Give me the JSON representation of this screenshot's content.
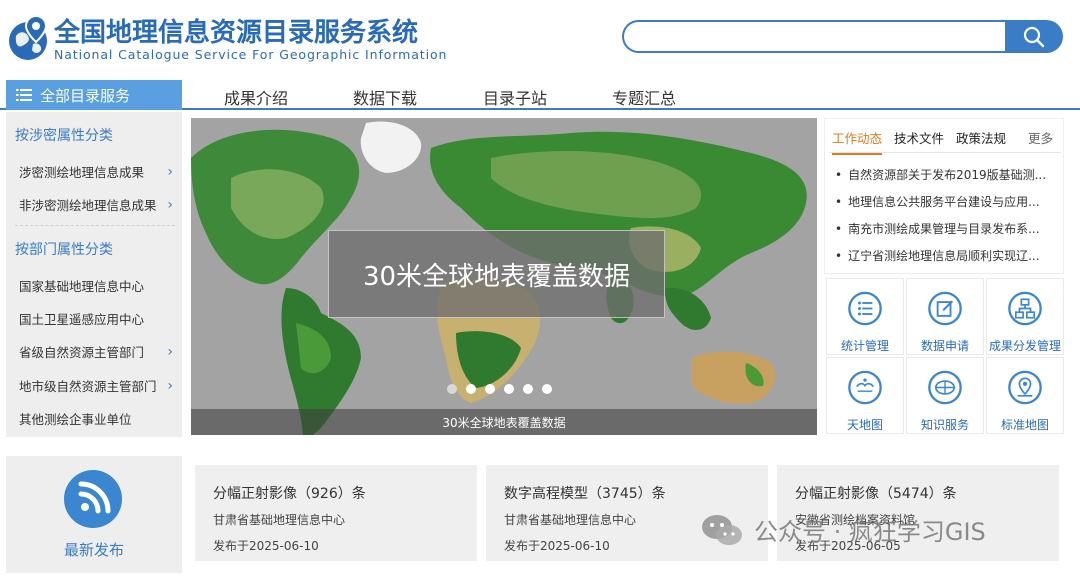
{
  "header": {
    "title_cn": "全国地理信息资源目录服务系统",
    "title_en": "National Catalogue Service For Geographic Information",
    "search": {
      "value": "",
      "placeholder": ""
    }
  },
  "nav": {
    "all_label": "全部目录服务",
    "items": [
      "成果介绍",
      "数据下载",
      "目录子站",
      "专题汇总"
    ]
  },
  "sidebar": {
    "group1_title": "按涉密属性分类",
    "group1_items": [
      "涉密测绘地理信息成果",
      "非涉密测绘地理信息成果"
    ],
    "group2_title": "按部门属性分类",
    "group2_items": [
      "国家基础地理信息中心",
      "国土卫星遥感应用中心",
      "省级自然资源主管部门",
      "地市级自然资源主管部门",
      "其他测绘企事业单位"
    ]
  },
  "banner": {
    "caption": "30米全球地表覆盖数据",
    "bottom_caption": "30米全球地表覆盖数据",
    "slide_count": 6,
    "active_index": 0
  },
  "news": {
    "tabs": [
      "工作动态",
      "技术文件",
      "政策法规"
    ],
    "more": "更多",
    "items": [
      "自然资源部关于发布2019版基础测...",
      "地理信息公共服务平台建设与应用...",
      "南充市测绘成果管理与目录发布系...",
      "辽宁省测绘地理信息局顺利实现辽..."
    ]
  },
  "services": [
    {
      "label": "统计管理",
      "icon": "list-icon"
    },
    {
      "label": "数据申请",
      "icon": "edit-icon"
    },
    {
      "label": "成果分发管理",
      "icon": "network-icon"
    },
    {
      "label": "天地图",
      "icon": "tianditu-icon"
    },
    {
      "label": "知识服务",
      "icon": "knowledge-icon"
    },
    {
      "label": "标准地图",
      "icon": "map-pin-icon"
    }
  ],
  "latest": {
    "label": "最新发布"
  },
  "cards": [
    {
      "title": "分幅正射影像（926）条",
      "org": "甘肃省基础地理信息中心",
      "date": "发布于2025-06-10"
    },
    {
      "title": "数字高程模型（3745）条",
      "org": "甘肃省基础地理信息中心",
      "date": "发布于2025-06-10"
    },
    {
      "title": "分幅正射影像（5474）条",
      "org": "安徽省测绘档案资料馆",
      "date": "发布于2025-06-05"
    }
  ],
  "watermark": {
    "text": "公众号 · 疯狂学习GIS"
  },
  "colors": {
    "brand": "#3a7cc6",
    "accent": "#e07a1a",
    "nav_all_bg": "#5aa0e0"
  }
}
